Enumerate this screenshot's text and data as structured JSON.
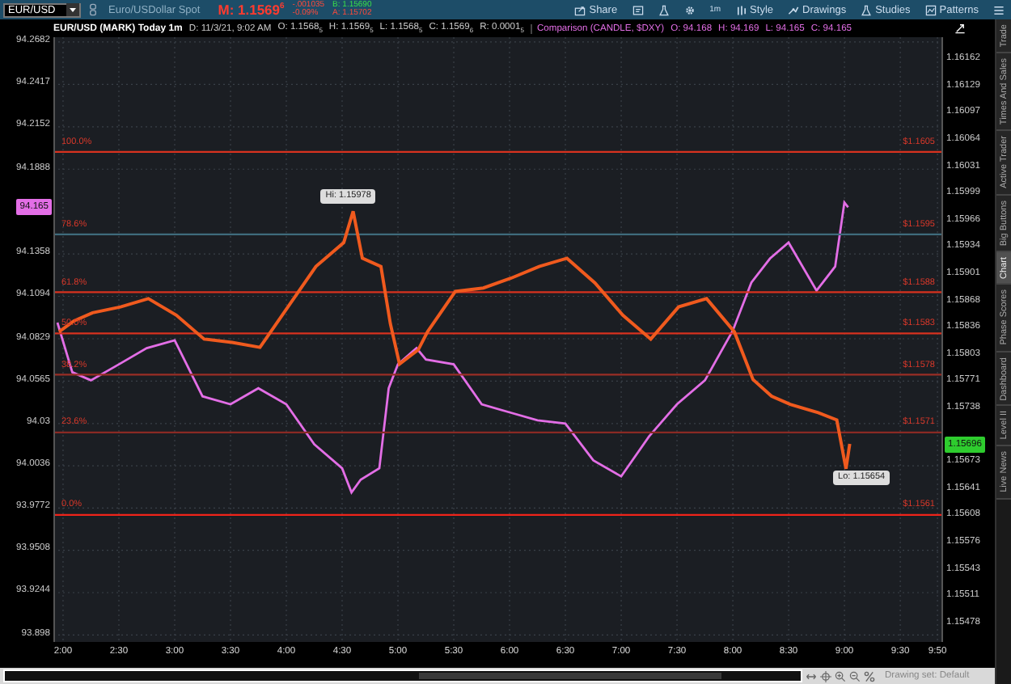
{
  "toolbar": {
    "symbol": "EUR/USD",
    "description": "Euro/USDollar Spot",
    "mark": "M: 1.1569$^{6}$",
    "change": "-.001035",
    "change_pct": "-0.09%",
    "bid": "B: 1.15690",
    "ask": "A: 1.15702",
    "buttons": [
      {
        "kind": "share",
        "label": "Share"
      },
      {
        "kind": "notes"
      },
      {
        "kind": "flask"
      },
      {
        "kind": "gear"
      },
      {
        "kind": "text",
        "label": "1m"
      },
      {
        "kind": "style",
        "label": "Style"
      },
      {
        "kind": "drawings",
        "label": "Drawings"
      },
      {
        "kind": "flask",
        "label": "Studies"
      },
      {
        "kind": "patterns",
        "label": "Patterns"
      },
      {
        "kind": "menu"
      }
    ]
  },
  "info_bar": {
    "title": "EUR/USD (MARK) Today 1m",
    "fields": [
      "D: 11/3/21, 9:02 AM",
      "O: 1.1568$_{5}$",
      "H: 1.1569$_{5}$",
      "L: 1.1568$_{5}$",
      "C: 1.1569$_{6}$",
      "R: 0.0001$_{5}$"
    ],
    "comparison": "Comparison (CANDLE, $DXY)",
    "comparison_fields": [
      "O: 94.168",
      "H: 94.169",
      "L: 94.165",
      "C: 94.165"
    ]
  },
  "chart": {
    "chart_data": {
      "type": "line",
      "x": [
        1.95,
        2.0833,
        2.25,
        2.5,
        2.75,
        3,
        3.25,
        3.5,
        3.75,
        4,
        4.25,
        4.5,
        4.5833,
        4.6667,
        4.8333,
        4.9167,
        5,
        5.1667,
        5.25,
        5.5,
        5.75,
        6,
        6.25,
        6.5,
        6.75,
        7,
        7.25,
        7.5,
        7.75,
        8,
        8.1667,
        8.3333,
        8.5,
        8.75,
        8.9167,
        9,
        9.0333
      ],
      "series": [
        {
          "color": "#f05a1e",
          "values": [
            1.15832,
            1.15845,
            1.15855,
            1.15862,
            1.15872,
            1.15852,
            1.15823,
            1.15819,
            1.15813,
            1.15862,
            1.15911,
            1.1594,
            1.15978,
            1.15921,
            1.15911,
            1.15842,
            1.15793,
            1.1581,
            1.15832,
            1.15881,
            1.15885,
            1.15897,
            1.15911,
            1.15921,
            1.15891,
            1.15852,
            1.15823,
            1.15862,
            1.15872,
            1.15832,
            1.15774,
            1.15754,
            1.15744,
            1.15734,
            1.15725,
            1.15666,
            1.15696
          ]
        }
      ],
      "xlim": [
        1.9133,
        9.8833
      ],
      "ylim": [
        1.15456,
        1.16189
      ],
      "xticks": [
        {
          "value": 2,
          "label": "2:00"
        },
        {
          "value": 2.5,
          "label": "2:30"
        },
        {
          "value": 3,
          "label": "3:00"
        },
        {
          "value": 3.5,
          "label": "3:30"
        },
        {
          "value": 4,
          "label": "4:00"
        },
        {
          "value": 4.5,
          "label": "4:30"
        },
        {
          "value": 5,
          "label": "5:00"
        },
        {
          "value": 5.5,
          "label": "5:30"
        },
        {
          "value": 6,
          "label": "6:00"
        },
        {
          "value": 6.5,
          "label": "6:30"
        },
        {
          "value": 7,
          "label": "7:00"
        },
        {
          "value": 7.5,
          "label": "7:30"
        },
        {
          "value": 8,
          "label": "8:00"
        },
        {
          "value": 8.5,
          "label": "8:30"
        },
        {
          "value": 9,
          "label": "9:00"
        },
        {
          "value": 9.5,
          "label": "9:30"
        },
        {
          "value": 9.8333,
          "label": "9:50"
        }
      ],
      "yticks": [
        1.16162,
        1.16129,
        1.16097,
        1.16064,
        1.16031,
        1.15999,
        1.15966,
        1.15934,
        1.15901,
        1.15868,
        1.15836,
        1.15803,
        1.15771,
        1.15738,
        1.15673,
        1.15641,
        1.15608,
        1.15576,
        1.15543,
        1.15511,
        1.15478
      ],
      "ref_lines": [
        {
          "axis": "y",
          "value": 1.1605,
          "label": "$1.1605",
          "color": "#d8321f"
        },
        {
          "axis": "y",
          "value": 1.1595,
          "label": "$1.1595",
          "color": "#3f6b7c"
        },
        {
          "axis": "y",
          "value": 1.1588,
          "label": "$1.1588",
          "color": "#d8321f"
        },
        {
          "axis": "y",
          "value": 1.1583,
          "label": "$1.1583",
          "color": "#d8321f"
        },
        {
          "axis": "y",
          "value": 1.1578,
          "label": "$1.1578",
          "color": "#9a2e26"
        },
        {
          "axis": "y",
          "value": 1.1571,
          "label": "$1.1571",
          "color": "#8a2a24"
        },
        {
          "axis": "y",
          "value": 1.1561,
          "label": "$1.1561",
          "color": "#f0241a"
        }
      ],
      "annotations": [
        "100.0%",
        "78.6%",
        "61.8%",
        "50.0%",
        "38.2%",
        "23.6%",
        "0.0%",
        "Hi: 1.15978",
        "Lo: 1.15654",
        "1.15696"
      ]
    }
  },
  "comparison_chart": {
    "chart_data": {
      "type": "line",
      "x": [
        1.95,
        2.0833,
        2.25,
        2.5,
        2.75,
        3,
        3.25,
        3.5,
        3.75,
        4,
        4.25,
        4.5,
        4.5833,
        4.6667,
        4.8333,
        4.9167,
        5,
        5.1667,
        5.25,
        5.5,
        5.75,
        6,
        6.25,
        6.5,
        6.75,
        7,
        7.25,
        7.5,
        7.75,
        8,
        8.1667,
        8.3333,
        8.5,
        8.75,
        8.9167,
        9,
        9.0333
      ],
      "series": [
        {
          "color": "#e36ee6",
          "values": [
            94.093,
            94.062,
            94.057,
            94.067,
            94.077,
            94.082,
            94.047,
            94.042,
            94.052,
            94.042,
            94.017,
            94.002,
            93.987,
            93.995,
            94.002,
            94.052,
            94.067,
            94.077,
            94.07,
            94.067,
            94.042,
            94.037,
            94.032,
            94.03,
            94.007,
            93.997,
            94.022,
            94.042,
            94.057,
            94.088,
            94.118,
            94.133,
            94.143,
            94.113,
            94.128,
            94.168,
            94.165
          ]
        }
      ],
      "grid": true,
      "xlim": [
        1.9133,
        9.8833
      ],
      "ylim": [
        93.8936,
        94.2712
      ],
      "yticks": [
        94.2682,
        94.2417,
        94.2152,
        94.1888,
        94.1358,
        94.1094,
        94.0829,
        94.0565,
        94.03,
        94.0036,
        93.9772,
        93.9508,
        93.9244,
        93.898
      ],
      "annotations": [
        "94.165"
      ]
    }
  },
  "status_bar": {
    "drawing_set": "Drawing set: Default"
  },
  "side_tabs": [
    {
      "label": "Trade",
      "selected": false
    },
    {
      "label": "Times And Sales",
      "selected": false
    },
    {
      "label": "Active Trader",
      "selected": false
    },
    {
      "label": "Big Buttons",
      "selected": false
    },
    {
      "label": "Chart",
      "selected": true
    },
    {
      "label": "Phase Scores",
      "selected": false
    },
    {
      "label": "Dashboard",
      "selected": false
    },
    {
      "label": "Level II",
      "selected": false
    },
    {
      "label": "Live News",
      "selected": false
    }
  ]
}
